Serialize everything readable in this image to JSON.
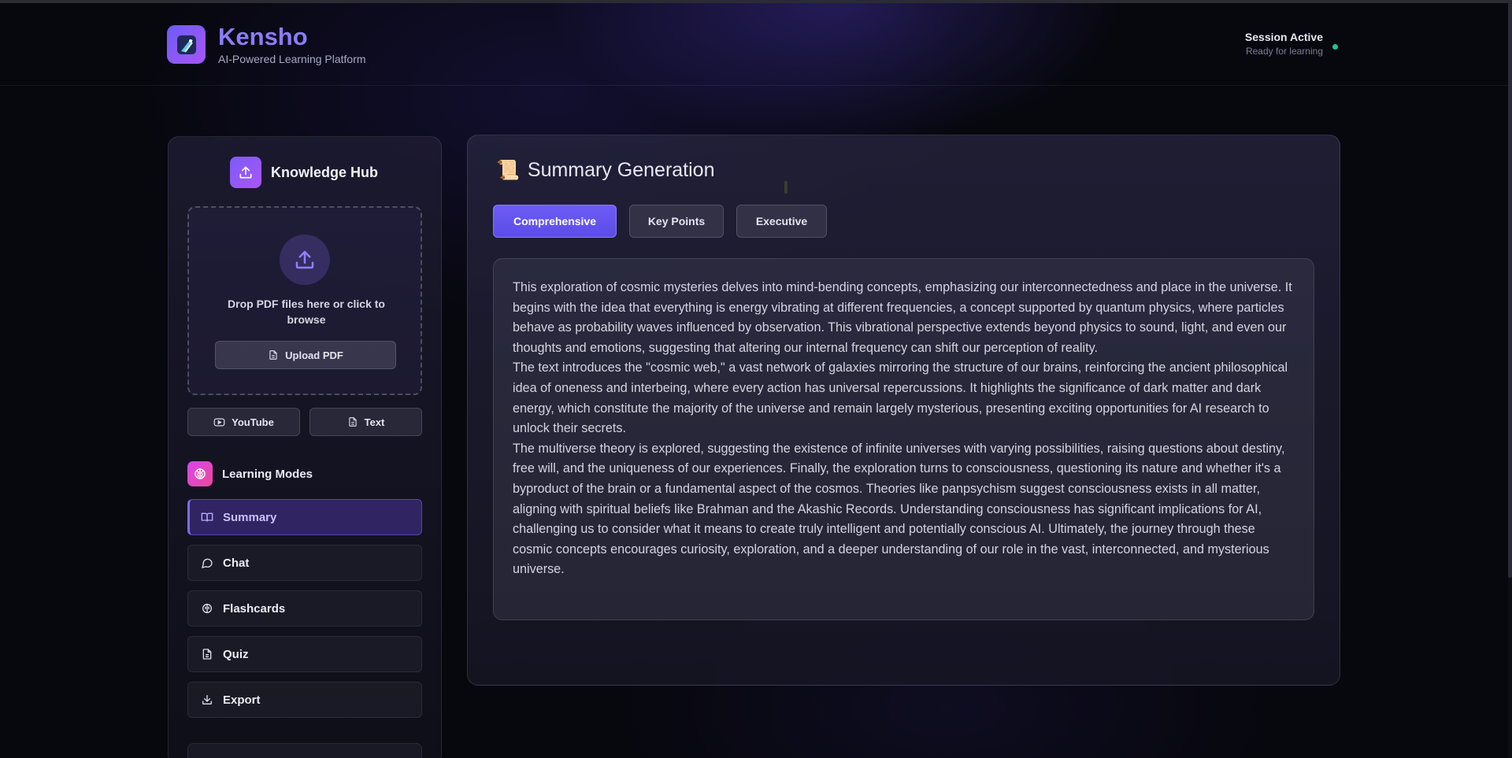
{
  "header": {
    "brand_name": "Kensho",
    "brand_sub": "AI-Powered Learning Platform",
    "session_title": "Session Active",
    "session_sub": "Ready for learning",
    "session_status_color": "#22c58b"
  },
  "sidebar": {
    "hub_title": "Knowledge Hub",
    "drop_text": "Drop PDF files here or click to browse",
    "upload_label": "Upload PDF",
    "youtube_label": "YouTube",
    "text_label": "Text",
    "modes_title": "Learning Modes",
    "modes": [
      {
        "label": "Summary",
        "icon": "book-open-icon",
        "active": true
      },
      {
        "label": "Chat",
        "icon": "chat-bubble-icon",
        "active": false
      },
      {
        "label": "Flashcards",
        "icon": "brain-icon",
        "active": false
      },
      {
        "label": "Quiz",
        "icon": "document-icon",
        "active": false
      },
      {
        "label": "Export",
        "icon": "download-icon",
        "active": false
      }
    ]
  },
  "main": {
    "title_emoji": "📜",
    "title": "Summary Generation",
    "tabs": [
      {
        "label": "Comprehensive",
        "active": true
      },
      {
        "label": "Key Points",
        "active": false
      },
      {
        "label": "Executive",
        "active": false
      }
    ],
    "paragraphs": [
      "This exploration of cosmic mysteries delves into mind-bending concepts, emphasizing our interconnectedness and place in the universe. It begins with the idea that everything is energy vibrating at different frequencies, a concept supported by quantum physics, where particles behave as probability waves influenced by observation. This vibrational perspective extends beyond physics to sound, light, and even our thoughts and emotions, suggesting that altering our internal frequency can shift our perception of reality.",
      "The text introduces the \"cosmic web,\" a vast network of galaxies mirroring the structure of our brains, reinforcing the ancient philosophical idea of oneness and interbeing, where every action has universal repercussions. It highlights the significance of dark matter and dark energy, which constitute the majority of the universe and remain largely mysterious, presenting exciting opportunities for AI research to unlock their secrets.",
      "The multiverse theory is explored, suggesting the existence of infinite universes with varying possibilities, raising questions about destiny, free will, and the uniqueness of our experiences. Finally, the exploration turns to consciousness, questioning its nature and whether it's a byproduct of the brain or a fundamental aspect of the cosmos. Theories like panpsychism suggest consciousness exists in all matter, aligning with spiritual beliefs like Brahman and the Akashic Records. Understanding consciousness has significant implications for AI, challenging us to consider what it means to create truly intelligent and potentially conscious AI. Ultimately, the journey through these cosmic concepts encourages curiosity, exploration, and a deeper understanding of our role in the vast, interconnected, and mysterious universe."
    ]
  },
  "colors": {
    "accent": "#6d5cf6",
    "background": "#07070e"
  }
}
